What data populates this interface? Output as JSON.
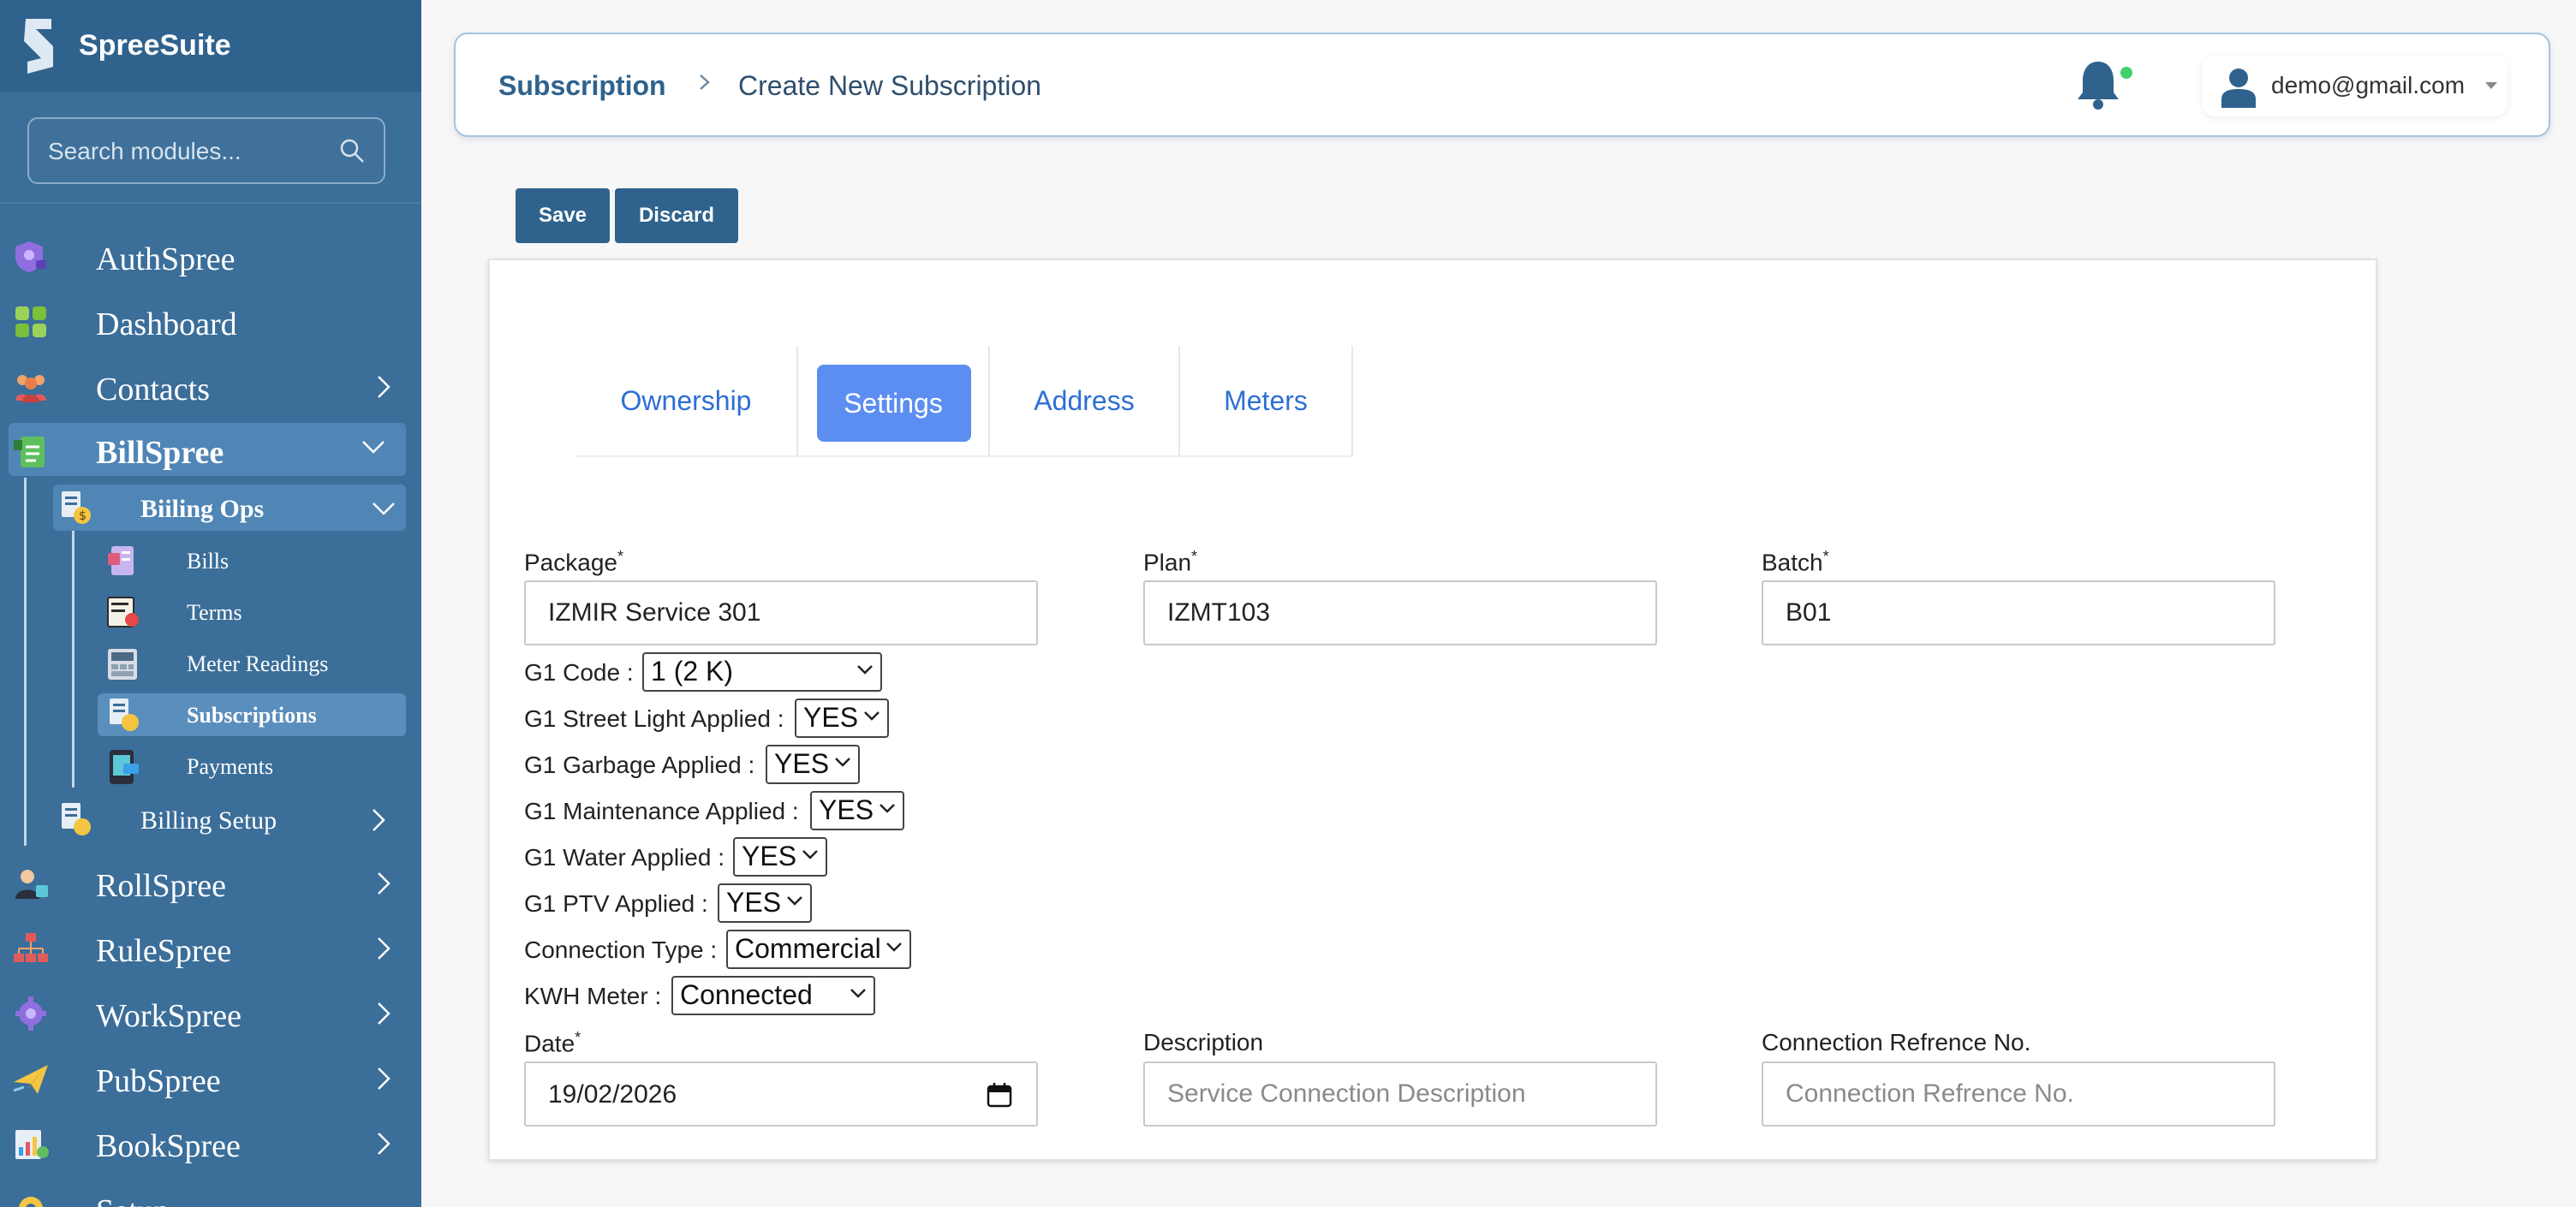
{
  "brand": {
    "name": "SpreeSuite"
  },
  "search": {
    "placeholder": "Search modules..."
  },
  "sidebar": {
    "items": [
      {
        "label": "AuthSpree"
      },
      {
        "label": "Dashboard"
      },
      {
        "label": "Contacts"
      },
      {
        "label": "BillSpree"
      },
      {
        "label": "RollSpree"
      },
      {
        "label": "RuleSpree"
      },
      {
        "label": "WorkSpree"
      },
      {
        "label": "PubSpree"
      },
      {
        "label": "BookSpree"
      },
      {
        "label": "Setup"
      }
    ],
    "billspree_children": {
      "billing_ops": "Biiling Ops",
      "billing_setup": "Billing Setup",
      "ops_items": [
        {
          "label": "Bills"
        },
        {
          "label": "Terms"
        },
        {
          "label": "Meter Readings"
        },
        {
          "label": "Subscriptions"
        },
        {
          "label": "Payments"
        }
      ]
    }
  },
  "header": {
    "breadcrumb_root": "Subscription",
    "breadcrumb_current": "Create New Subscription",
    "user_email": "demo@gmail.com"
  },
  "actions": {
    "save": "Save",
    "discard": "Discard"
  },
  "tabs": [
    {
      "label": "Ownership"
    },
    {
      "label": "Settings"
    },
    {
      "label": "Address"
    },
    {
      "label": "Meters"
    }
  ],
  "form": {
    "package": {
      "label": "Package",
      "value": "IZMIR Service 301"
    },
    "plan": {
      "label": "Plan",
      "value": "IZMT103"
    },
    "batch": {
      "label": "Batch",
      "value": "B01"
    },
    "selects": [
      {
        "label": "G1 Code",
        "value": "1 (2 K)"
      },
      {
        "label": "G1 Street Light Applied",
        "value": "YES"
      },
      {
        "label": "G1 Garbage Applied",
        "value": "YES"
      },
      {
        "label": "G1 Maintenance Applied",
        "value": "YES"
      },
      {
        "label": "G1 Water Applied",
        "value": "YES"
      },
      {
        "label": "G1 PTV Applied",
        "value": "YES"
      },
      {
        "label": "Connection Type",
        "value": "Commercial"
      },
      {
        "label": "KWH Meter",
        "value": "Connected"
      }
    ],
    "date": {
      "label": "Date",
      "value": "19/02/2026"
    },
    "description": {
      "label": "Description",
      "placeholder": "Service Connection Description"
    },
    "connection_ref": {
      "label": "Connection Refrence No.",
      "placeholder": "Connection Refrence No."
    }
  },
  "colors": {
    "sidebar": "#3b6e99",
    "primary": "#2f628d",
    "tab_active": "#5b8ef0",
    "link": "#2d6fd3"
  }
}
